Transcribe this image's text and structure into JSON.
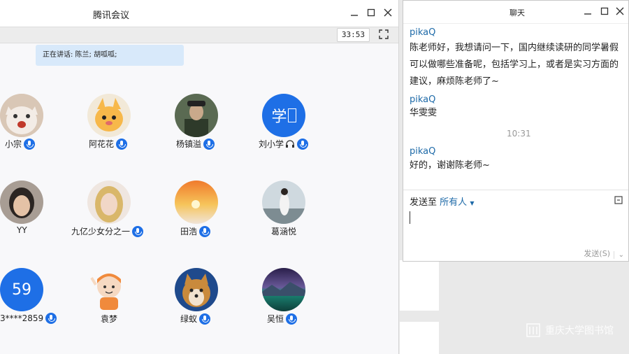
{
  "meeting_window": {
    "title": "腾讯会议",
    "timer": "33:53",
    "speaking_label": "正在讲话: 陈兰; 胡呱呱;",
    "participants": [
      {
        "name": "小宗",
        "status": "mic"
      },
      {
        "name": "阿花花",
        "status": "mic"
      },
      {
        "name": "杨镇溢",
        "status": "mic"
      },
      {
        "name": "刘小学",
        "status": "headset",
        "avatar_text": "学"
      },
      {
        "name": "YY",
        "status": "none"
      },
      {
        "name": "九亿少女分之一",
        "status": "mic"
      },
      {
        "name": "田浩",
        "status": "mic"
      },
      {
        "name": "葛涵悦",
        "status": "none"
      },
      {
        "name": "3****2859",
        "status": "mic",
        "avatar_text": "59"
      },
      {
        "name": "袁梦",
        "status": "none"
      },
      {
        "name": "绿蚁",
        "status": "mic"
      },
      {
        "name": "吴恒",
        "status": "mic"
      }
    ]
  },
  "chat_window": {
    "title": "聊天",
    "messages": [
      {
        "sender": "pikaQ",
        "text": "陈老师好，我想请问一下，国内继续读研的同学暑假可以做哪些准备呢，包括学习上，或者是实习方面的建议，麻烦陈老师了~"
      },
      {
        "sender": "pikaQ",
        "text": "华雯雯"
      },
      {
        "time": "10:31"
      },
      {
        "sender": "pikaQ",
        "text": "好的，谢谢陈老师~"
      }
    ],
    "send_to_label": "发送至",
    "send_to_target": "所有人",
    "send_button": "发送(S)"
  },
  "watermark": "重庆大学图书馆",
  "colors": {
    "accent": "#1e6fe6",
    "link": "#1e6aa8",
    "speaking_bg": "#d8e9fa"
  }
}
